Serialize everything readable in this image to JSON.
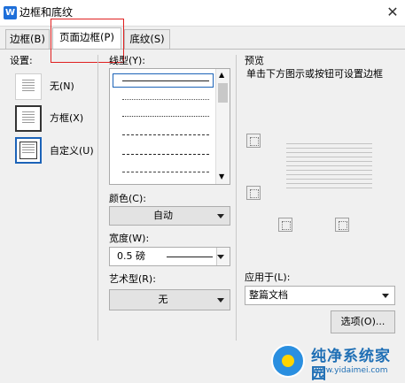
{
  "window": {
    "title": "边框和底纹",
    "app_icon_letter": "W",
    "close_glyph": "✕"
  },
  "tabs": [
    {
      "label": "边框(B)"
    },
    {
      "label": "页面边框(P)",
      "active": true
    },
    {
      "label": "底纹(S)"
    }
  ],
  "settings": {
    "label": "设置:",
    "options": [
      {
        "label": "无(N)"
      },
      {
        "label": "方框(X)"
      },
      {
        "label": "自定义(U)",
        "selected": true
      }
    ]
  },
  "line_style": {
    "label": "线型(Y):",
    "items": [
      "solid",
      "dotted-fine",
      "dotted",
      "dashed-short",
      "dashed",
      "dash-dot",
      "dash-dot-dot"
    ]
  },
  "color": {
    "label": "颜色(C):",
    "value": "自动"
  },
  "width": {
    "label": "宽度(W):",
    "value": "0.5 磅"
  },
  "art": {
    "label": "艺术型(R):",
    "value": "无"
  },
  "preview": {
    "label": "预览",
    "hint": "单击下方图示或按钮可设置边框"
  },
  "apply_to": {
    "label": "应用于(L):",
    "value": "整篇文档"
  },
  "options_button": "选项(O)...",
  "watermark": {
    "title": "纯净系统家园",
    "url": "www.yidaimei.com"
  },
  "colors": {
    "accent": "#1c63b8",
    "highlight": "#e02020"
  }
}
